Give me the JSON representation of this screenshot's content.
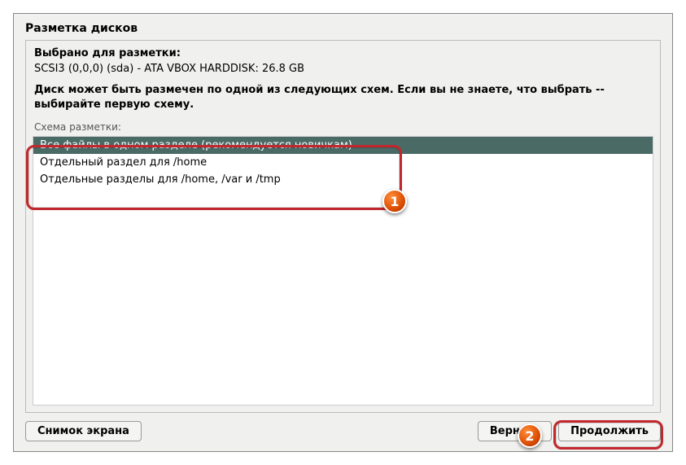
{
  "window": {
    "title": "Разметка дисков"
  },
  "info": {
    "selected_heading": "Выбрано для разметки:",
    "disk": "SCSI3 (0,0,0) (sda) - ATA VBOX HARDDISK: 26.8 GB",
    "description": "Диск может быть размечен по одной из следующих схем. Если вы не знаете, что выбрать -- выбирайте первую схему.",
    "scheme_label": "Схема разметки:"
  },
  "list": {
    "items": [
      {
        "label": "Все файлы в одном разделе (рекомендуется новичкам)",
        "selected": true
      },
      {
        "label": "Отдельный раздел для /home",
        "selected": false
      },
      {
        "label": "Отдельные разделы для /home, /var и /tmp",
        "selected": false
      }
    ]
  },
  "buttons": {
    "screenshot": "Снимок экрана",
    "back": "Вернуть",
    "continue": "Продолжить"
  },
  "annotations": {
    "call1": "1",
    "call2": "2"
  }
}
